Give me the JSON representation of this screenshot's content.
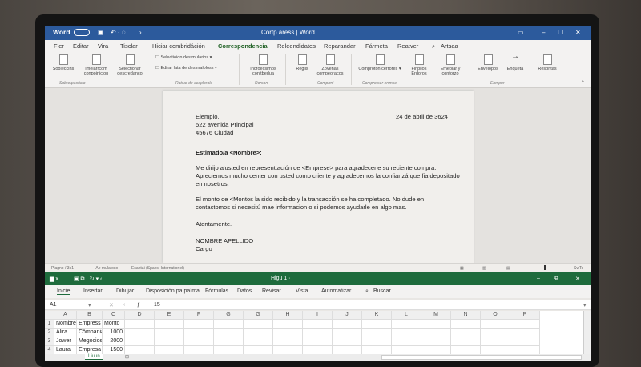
{
  "word": {
    "app_label": "Word",
    "title": "Cortp aress  |  Word",
    "tabs": [
      "Fier",
      "Editar",
      "Vira",
      "Tisclar",
      "Hiciar combridáción",
      "Correspondencia",
      "Releendidatos",
      "Reparandar",
      "Fármeta",
      "Reatver"
    ],
    "active_tab": "Correspondencia",
    "search_label": "Artsaa",
    "ribbon": {
      "buttons": [
        "Sobleccins",
        "Imelarrcom conpoinicion",
        "Selectionar descredanco",
        "Selectioion destmularios",
        "Edirar lata de desimaloloss",
        "Incroecsimps conltbedua",
        "Reglis",
        "Zovenas compeoracos",
        "Comproton cerrores",
        "Finplios Erdoros",
        "Emebiar y contorzo",
        "Envelopos",
        "Enqueta",
        "Respntas"
      ],
      "groups": [
        "Sobrerpasriolo",
        "Ratsar de ecaplorolo",
        "Rorsorr",
        "Comprmi",
        "Comprotser errmse",
        "Enmpur"
      ]
    },
    "document": {
      "sender_name": "Elempio.",
      "address": "522 avenida Principal",
      "city": "45676 Cludad",
      "date": "24 de abril de 3624",
      "greeting": "Estimado/a <Nombre>:",
      "paragraph1": "Me dirijo a'usted en representtación de <Emprese> para agradecerle su reciente compra. Apreciemos mucho center con usted como criente y agradecemos la confianzá que fia depositado en nosetros.",
      "paragraph2": "El monto de <Montos la sido recibido y la transacción se ha completado. No dude en contactomos si necesitú mae informacion o si podemos ayudarle en algo mas.",
      "closing": "Atentamente.",
      "signature_name": "NOMBRE APELLIDO",
      "signature_title": "Cargo"
    },
    "status": {
      "page": "Piagno / 3e1",
      "words": "IAe mulatoso",
      "language": "Esantai (Spaes. Internationel)",
      "zoom": "SwTe"
    }
  },
  "excel": {
    "title": "Higü 1  ·",
    "tabs": [
      "Inicie",
      "Insertár",
      "Dibujar",
      "Disposición pa paíma",
      "Fórmulas",
      "Datos",
      "Revisar",
      "Vista",
      "Automatizar"
    ],
    "active_tab": "Inicie",
    "search_label": "Buscar",
    "name_box": "A1",
    "formula_value": "15",
    "columns": [
      "A",
      "B",
      "C",
      "D",
      "E",
      "F",
      "G",
      "G",
      "H",
      "I",
      "J",
      "K",
      "L",
      "M",
      "N",
      "O",
      "P"
    ],
    "rows": [
      {
        "num": "1",
        "cells": [
          "Nombre",
          "Empress",
          "Monto"
        ]
      },
      {
        "num": "2",
        "cells": [
          "Alira",
          "Cömpania A",
          "1000"
        ]
      },
      {
        "num": "3",
        "cells": [
          "Jower",
          "Megocios B",
          "2000"
        ]
      },
      {
        "num": "4",
        "cells": [
          "Laura",
          "Empresa C",
          "1500"
        ]
      }
    ],
    "sheet_tab": "Liuun"
  },
  "colors": {
    "word_blue": "#2c5a9c",
    "excel_green": "#1e6b3c"
  }
}
